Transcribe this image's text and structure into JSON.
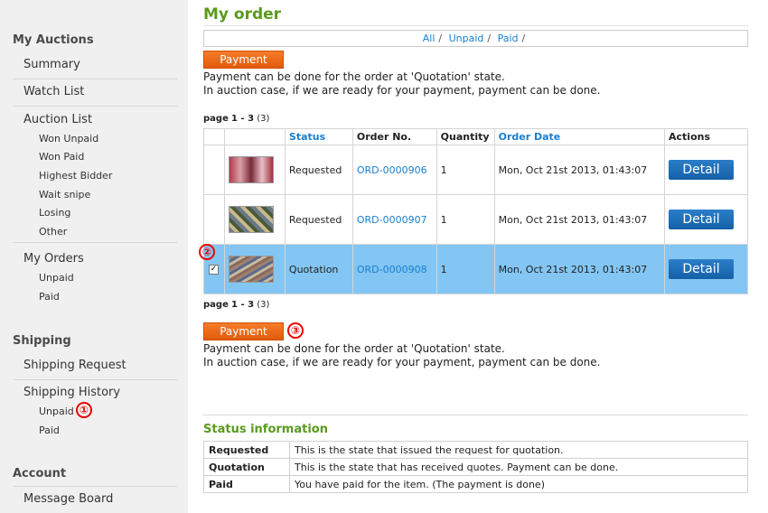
{
  "sidebar": {
    "auctions_title": "My Auctions",
    "summary": "Summary",
    "watch_list": "Watch List",
    "auction_list": "Auction List",
    "auction_sub": [
      "Won Unpaid",
      "Won Paid",
      "Highest Bidder",
      "Wait snipe",
      "Losing",
      "Other"
    ],
    "my_orders": "My Orders",
    "orders_sub": [
      "Unpaid",
      "Paid"
    ],
    "shipping_title": "Shipping",
    "shipping_request": "Shipping Request",
    "shipping_history": "Shipping History",
    "shipping_sub": [
      "Unpaid",
      "Paid"
    ],
    "account_title": "Account",
    "message_board": "Message Board"
  },
  "markers": [
    "①",
    "②",
    "③"
  ],
  "page_title": "My order",
  "filters": [
    "All",
    "Unpaid",
    "Paid"
  ],
  "filter_sep": "/",
  "payment_label": "Payment",
  "note_line1": "Payment can be done for the order at 'Quotation' state.",
  "note_line2": "In auction case, if we are ready for your payment, payment can be done.",
  "pager": {
    "label": "page",
    "range": "1 - 3",
    "total": "(3)"
  },
  "table": {
    "headers": [
      "Status",
      "Order No.",
      "Quantity",
      "Order Date",
      "Actions"
    ],
    "rows": [
      {
        "status": "Requested",
        "order_no": "ORD-0000906",
        "qty": "1",
        "date": "Mon, Oct 21st 2013, 01:43:07",
        "action": "Detail"
      },
      {
        "status": "Requested",
        "order_no": "ORD-0000907",
        "qty": "1",
        "date": "Mon, Oct 21st 2013, 01:43:07",
        "action": "Detail"
      },
      {
        "status": "Quotation",
        "order_no": "ORD-0000908",
        "qty": "1",
        "date": "Mon, Oct 21st 2013, 01:43:07",
        "action": "Detail"
      }
    ]
  },
  "status_info": {
    "title": "Status information",
    "rows": [
      {
        "k": "Requested",
        "v": "This is the state that issued the request for quotation."
      },
      {
        "k": "Quotation",
        "v": "This is the state that has received quotes. Payment can be done."
      },
      {
        "k": "Paid",
        "v": "You have paid for the item. (The payment is done)"
      }
    ]
  },
  "colors": {
    "accent_green": "#5a9a1e",
    "link_blue": "#1a7fd0",
    "button_orange": "#f06c1c",
    "selected_row": "#83c6f3"
  }
}
